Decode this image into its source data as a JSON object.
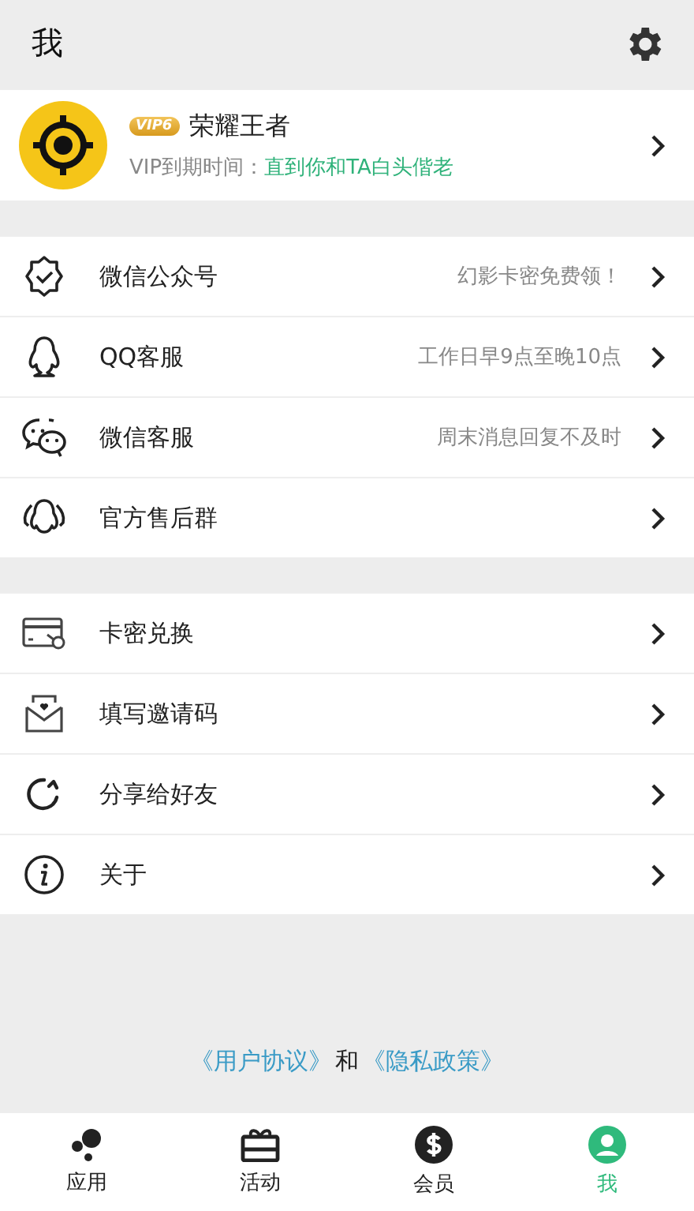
{
  "header": {
    "title": "我"
  },
  "profile": {
    "badge": "VIP6",
    "name": "荣耀王者",
    "expiry_label": "VIP到期时间：",
    "expiry_value": "直到你和TA白头偕老"
  },
  "menu_groups": [
    {
      "items": [
        {
          "label": "微信公众号",
          "hint": "幻影卡密免费领！"
        },
        {
          "label": "QQ客服",
          "hint": "工作日早9点至晚10点"
        },
        {
          "label": "微信客服",
          "hint": "周末消息回复不及时"
        },
        {
          "label": "官方售后群"
        }
      ]
    },
    {
      "items": [
        {
          "label": "卡密兑换"
        },
        {
          "label": "填写邀请码"
        },
        {
          "label": "分享给好友"
        },
        {
          "label": "关于"
        }
      ]
    }
  ],
  "footer": {
    "link_1": "《用户协议》",
    "joiner": "和",
    "link_2": "《隐私政策》"
  },
  "tabs": [
    {
      "label": "应用",
      "selected": false
    },
    {
      "label": "活动",
      "selected": false
    },
    {
      "label": "会员",
      "selected": false
    },
    {
      "label": "我",
      "selected": true
    }
  ]
}
